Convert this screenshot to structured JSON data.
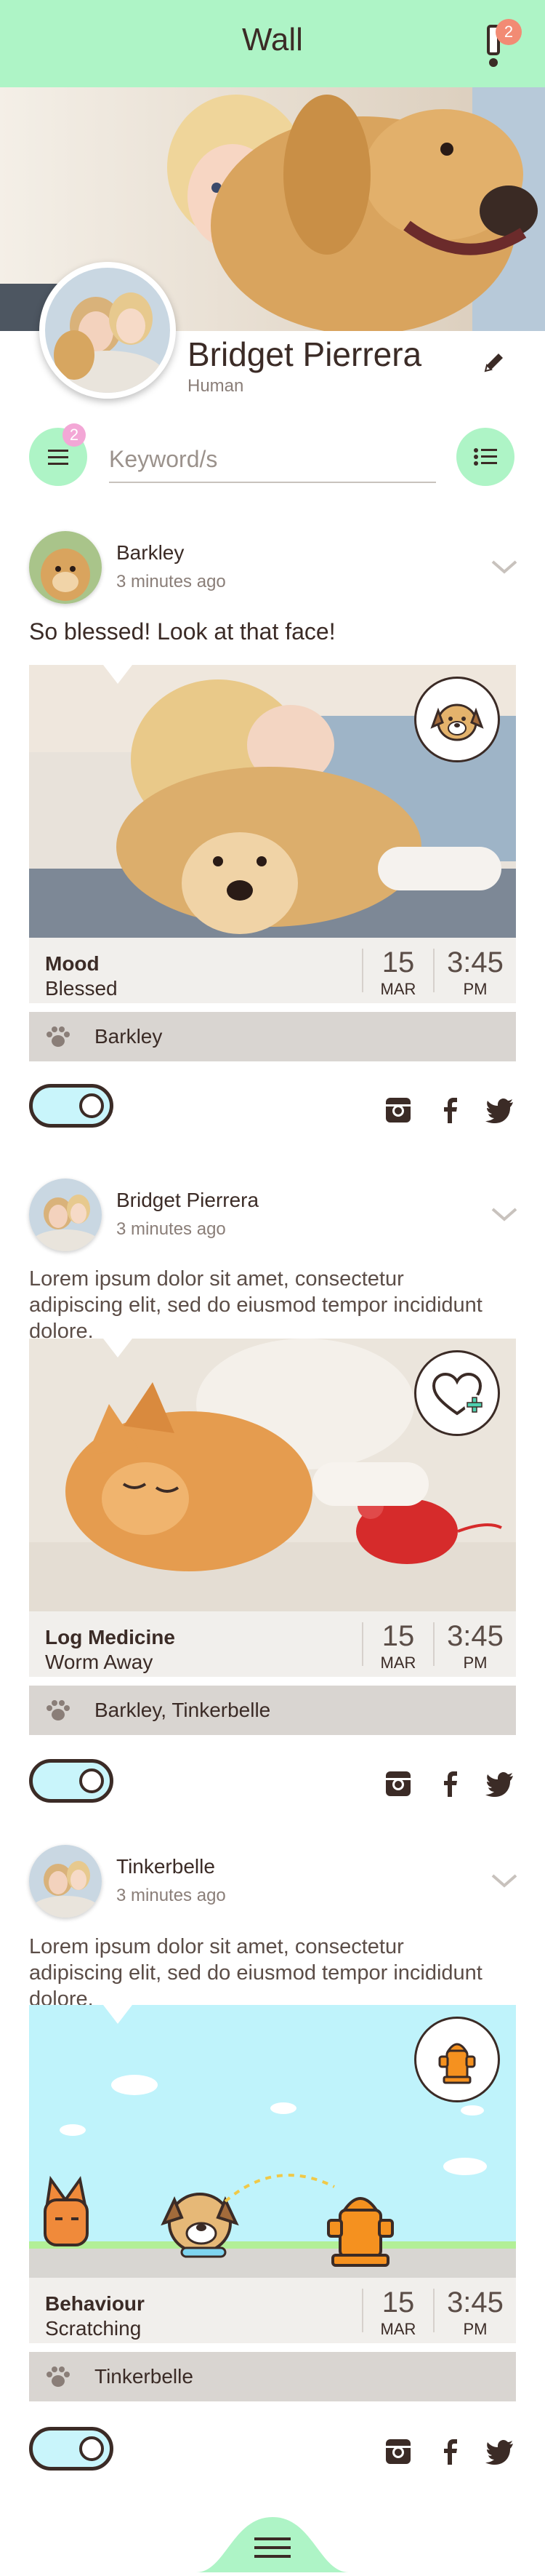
{
  "header": {
    "title": "Wall",
    "notification_count": "2",
    "accent": "#aef4c6",
    "badge_color": "#f28b74"
  },
  "profile": {
    "name": "Bridget Pierrera",
    "role": "Human"
  },
  "search": {
    "filter_count": "2",
    "placeholder": "Keyword/s"
  },
  "posts": [
    {
      "author": "Barkley",
      "time": "3 minutes ago",
      "text": "So blessed! Look at that face!",
      "photo": "child hugging golden retriever on sofa",
      "badge_icon": "dog-face-icon",
      "category": "Mood",
      "value": "Blessed",
      "day": "15",
      "month": "MAR",
      "time_of_day": "3:45",
      "ampm": "PM",
      "pets": "Barkley"
    },
    {
      "author": "Bridget Pierrera",
      "time": "3 minutes ago",
      "text": "Lorem ipsum dolor sit amet, consectetur adipiscing elit, sed do eiusmod tempor incididunt dolore.",
      "photo": "orange kitten sleeping with red toy mouse",
      "badge_icon": "heart-plus-icon",
      "category": "Log Medicine",
      "value": "Worm Away",
      "day": "15",
      "month": "MAR",
      "time_of_day": "3:45",
      "ampm": "PM",
      "pets": "Barkley, Tinkerbelle"
    },
    {
      "author": "Tinkerbelle",
      "time": "3 minutes ago",
      "text": "Lorem ipsum dolor sit amet, consectetur adipiscing elit, sed do eiusmod tempor incididunt dolore.",
      "photo": "cartoon cat, dog and fire hydrant",
      "badge_icon": "fire-hydrant-icon",
      "category": "Behaviour",
      "value": "Scratching",
      "day": "15",
      "month": "MAR",
      "time_of_day": "3:45",
      "ampm": "PM",
      "pets": "Tinkerbelle"
    }
  ],
  "social_icons": [
    "instagram-icon",
    "facebook-icon",
    "twitter-icon"
  ],
  "bottom_nav": {
    "icon": "menu-icon"
  }
}
